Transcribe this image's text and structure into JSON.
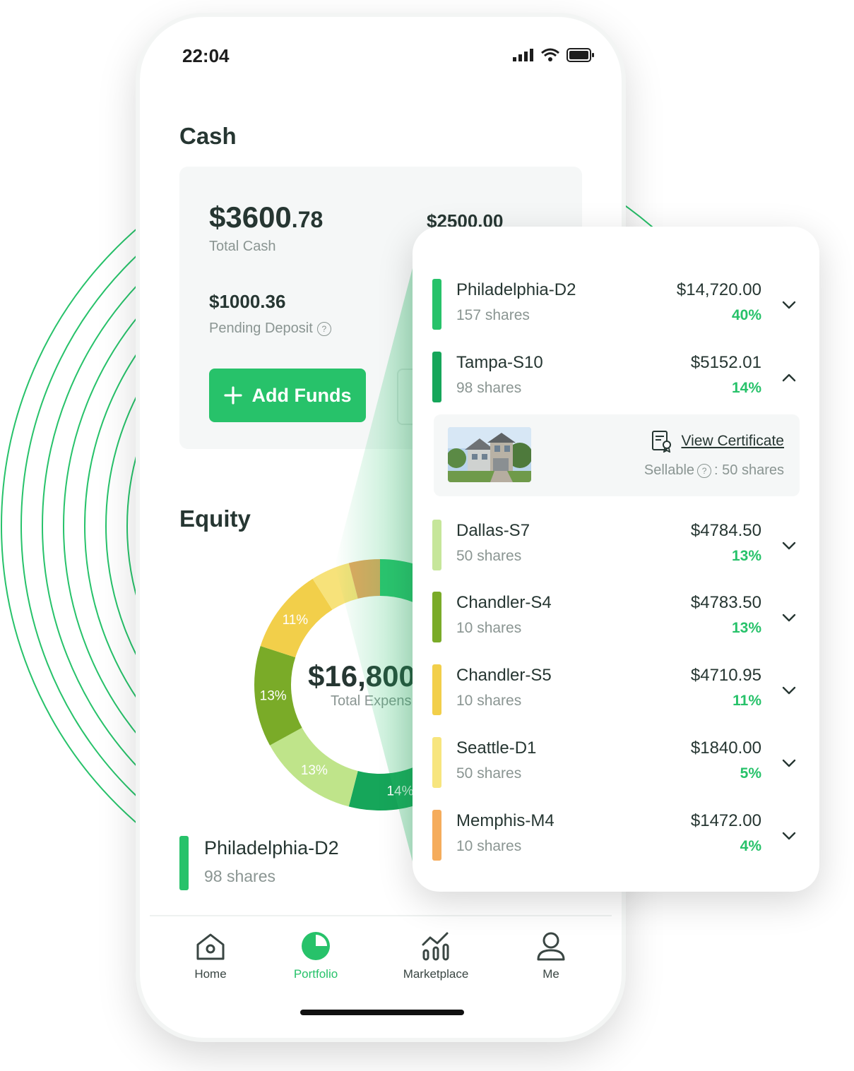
{
  "status_bar": {
    "time": "22:04"
  },
  "cash": {
    "section_title": "Cash",
    "total_whole": "$3600",
    "total_cents": ".78",
    "total_label": "Total Cash",
    "secondary_value": "$2500.00",
    "pending_value": "$1000.36",
    "pending_label": "Pending Deposit",
    "add_funds_label": "Add Funds"
  },
  "equity": {
    "section_title": "Equity",
    "center_value": "$16,800",
    "center_label": "Total Expens",
    "donut_labels": [
      "11%",
      "13%",
      "13%",
      "14%"
    ],
    "preview_item": {
      "name": "Philadelphia-D2",
      "shares": "98 shares"
    }
  },
  "donut_segments": [
    {
      "name": "Philadelphia-D2",
      "percent": 40,
      "color": "#2bc46f"
    },
    {
      "name": "Tampa-S10",
      "percent": 14,
      "color": "#16a65a"
    },
    {
      "name": "Dallas-S7",
      "percent": 13,
      "color": "#bfe48a"
    },
    {
      "name": "Chandler-S4",
      "percent": 13,
      "color": "#7aab28"
    },
    {
      "name": "Chandler-S5",
      "percent": 11,
      "color": "#f2cf4a"
    },
    {
      "name": "Seattle-D1",
      "percent": 5,
      "color": "#f7e27a"
    },
    {
      "name": "Memphis-M4",
      "percent": 4,
      "color": "#e3a75e"
    }
  ],
  "holdings": [
    {
      "name": "Philadelphia-D2",
      "shares": "157 shares",
      "value": "$14,720.00",
      "percent": "40%",
      "color": "#27c26a",
      "expanded": false
    },
    {
      "name": "Tampa-S10",
      "shares": "98 shares",
      "value": "$5152.01",
      "percent": "14%",
      "color": "#16a65a",
      "expanded": true
    },
    {
      "name": "Dallas-S7",
      "shares": "50 shares",
      "value": "$4784.50",
      "percent": "13%",
      "color": "#c6e69a",
      "expanded": false
    },
    {
      "name": "Chandler-S4",
      "shares": "10 shares",
      "value": "$4783.50",
      "percent": "13%",
      "color": "#7aab28",
      "expanded": false
    },
    {
      "name": "Chandler-S5",
      "shares": "10 shares",
      "value": "$4710.95",
      "percent": "11%",
      "color": "#f2cf4a",
      "expanded": false
    },
    {
      "name": "Seattle-D1",
      "shares": "50 shares",
      "value": "$1840.00",
      "percent": "5%",
      "color": "#f7e57e",
      "expanded": false
    },
    {
      "name": "Memphis-M4",
      "shares": "10 shares",
      "value": "$1472.00",
      "percent": "4%",
      "color": "#f5ac5c",
      "expanded": false
    }
  ],
  "expanded_detail": {
    "view_certificate_label": "View Certificate",
    "sellable_label": "Sellable",
    "sellable_value": ": 50 shares"
  },
  "nav": [
    {
      "label": "Home",
      "icon": "home-icon",
      "active": false
    },
    {
      "label": "Portfolio",
      "icon": "portfolio-icon",
      "active": true
    },
    {
      "label": "Marketplace",
      "icon": "marketplace-icon",
      "active": false
    },
    {
      "label": "Me",
      "icon": "profile-icon",
      "active": false
    }
  ],
  "colors": {
    "accent": "#27c26a",
    "text": "#263632",
    "muted": "#8a9592"
  }
}
